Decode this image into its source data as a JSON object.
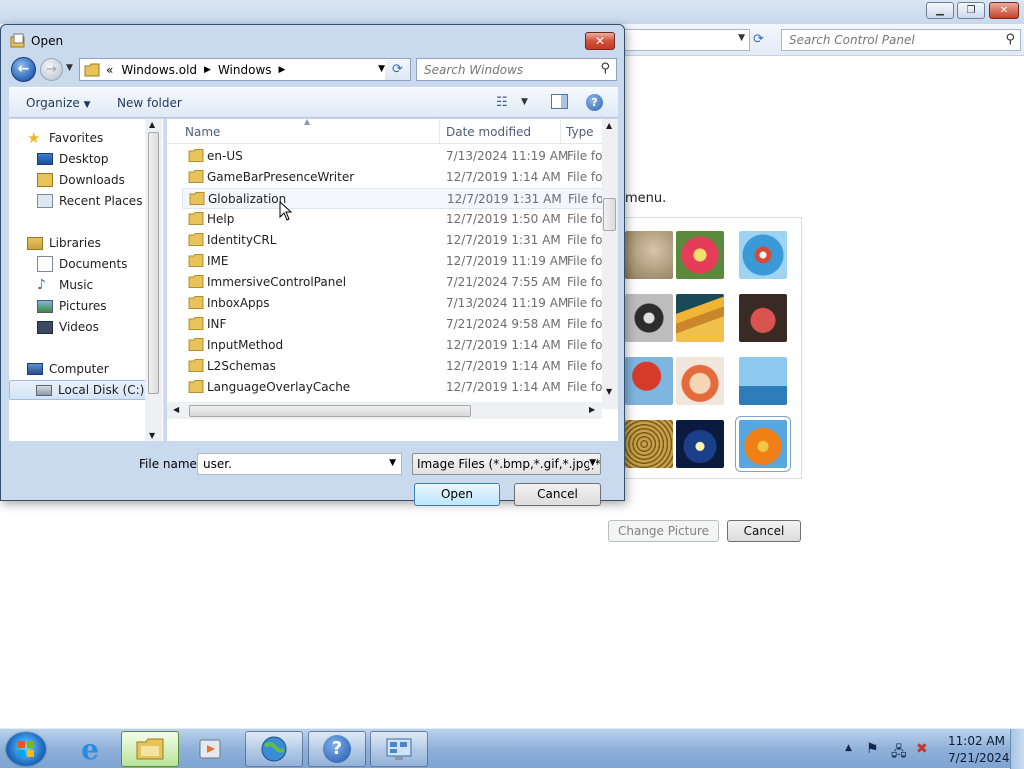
{
  "control_panel": {
    "search_placeholder": "Search Control Panel",
    "menu_text": "menu.",
    "change_picture_label": "Change Picture",
    "cancel_label": "Cancel"
  },
  "dialog": {
    "title": "Open",
    "breadcrumb": {
      "prefix": "«",
      "items": [
        "Windows.old",
        "Windows"
      ]
    },
    "search_placeholder": "Search Windows",
    "toolbar": {
      "organize_label": "Organize",
      "new_folder_label": "New folder"
    },
    "nav": {
      "items": [
        {
          "label": "Favorites",
          "icon": "star-icon"
        },
        {
          "label": "Desktop",
          "icon": "desktop-icon"
        },
        {
          "label": "Downloads",
          "icon": "downloads-icon"
        },
        {
          "label": "Recent Places",
          "icon": "recent-places-icon"
        },
        {
          "label": "Libraries",
          "icon": "libraries-icon"
        },
        {
          "label": "Documents",
          "icon": "documents-icon"
        },
        {
          "label": "Music",
          "icon": "music-icon"
        },
        {
          "label": "Pictures",
          "icon": "pictures-icon"
        },
        {
          "label": "Videos",
          "icon": "videos-icon"
        },
        {
          "label": "Computer",
          "icon": "computer-icon"
        },
        {
          "label": "Local Disk (C:)",
          "icon": "drive-icon"
        }
      ]
    },
    "columns": {
      "name": "Name",
      "date_modified": "Date modified",
      "type": "Type"
    },
    "files": [
      {
        "name": "en-US",
        "date": "7/13/2024 11:19 AM",
        "type": "File folder"
      },
      {
        "name": "GameBarPresenceWriter",
        "date": "12/7/2019 1:14 AM",
        "type": "File folder"
      },
      {
        "name": "Globalization",
        "date": "12/7/2019 1:31 AM",
        "type": "File folder"
      },
      {
        "name": "Help",
        "date": "12/7/2019 1:50 AM",
        "type": "File folder"
      },
      {
        "name": "IdentityCRL",
        "date": "12/7/2019 1:31 AM",
        "type": "File folder"
      },
      {
        "name": "IME",
        "date": "12/7/2019 11:19 AM",
        "type": "File folder"
      },
      {
        "name": "ImmersiveControlPanel",
        "date": "7/21/2024 7:55 AM",
        "type": "File folder"
      },
      {
        "name": "InboxApps",
        "date": "7/13/2024 11:19 AM",
        "type": "File folder"
      },
      {
        "name": "INF",
        "date": "7/21/2024 9:58 AM",
        "type": "File folder"
      },
      {
        "name": "InputMethod",
        "date": "12/7/2019 1:14 AM",
        "type": "File folder"
      },
      {
        "name": "L2Schemas",
        "date": "12/7/2019 1:14 AM",
        "type": "File folder"
      },
      {
        "name": "LanguageOverlayCache",
        "date": "12/7/2019 1:14 AM",
        "type": "File folder"
      }
    ],
    "file_name_label": "File name:",
    "file_name_value": "user.",
    "filter_value": "Image Files (*.bmp,*.gif,*.jpg,*.",
    "open_label": "Open",
    "cancel_label": "Cancel"
  },
  "taskbar": {
    "time": "11:02 AM",
    "date": "7/21/2024",
    "items": [
      "internet-explorer-icon",
      "windows-explorer-icon",
      "media-player-icon",
      "network-globe-icon",
      "help-icon",
      "control-panel-icon"
    ]
  },
  "colors": {
    "accent": "#2e6bb5",
    "folder": "#e8c25a",
    "taskbar": "#8fb1d9"
  }
}
